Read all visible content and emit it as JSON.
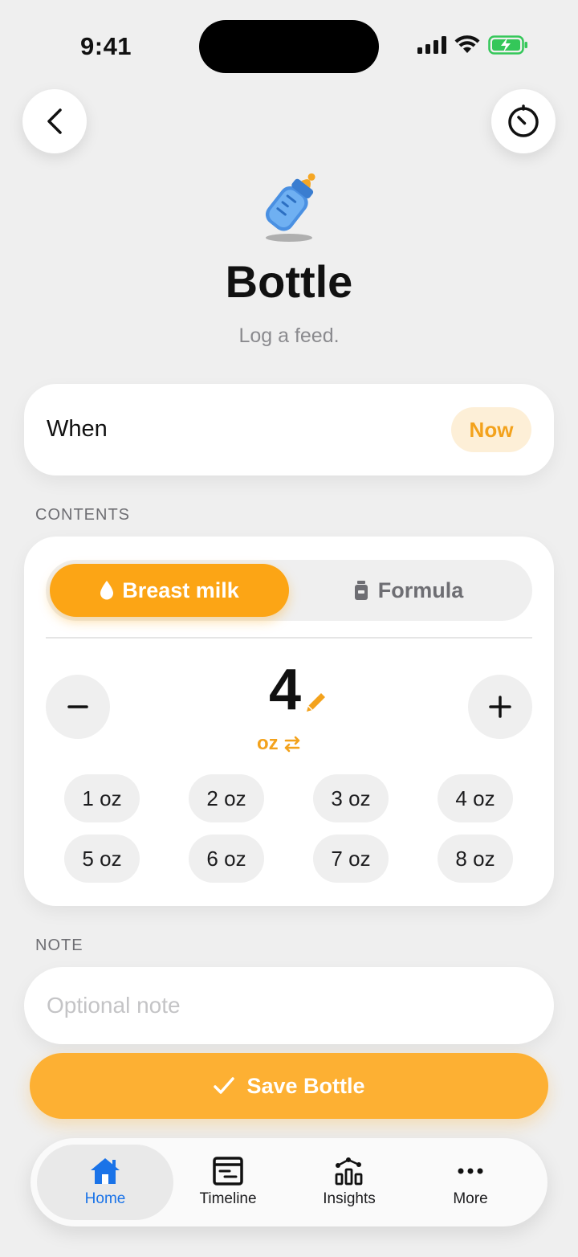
{
  "status_bar": {
    "time": "9:41"
  },
  "header": {
    "title": "Bottle",
    "subtitle": "Log a feed."
  },
  "when": {
    "label": "When",
    "value": "Now"
  },
  "contents": {
    "section_label": "CONTENTS",
    "segments": [
      {
        "label": "Breast milk",
        "icon": "droplet-icon",
        "selected": true
      },
      {
        "label": "Formula",
        "icon": "formula-can-icon",
        "selected": false
      }
    ],
    "amount": "4",
    "unit": "oz",
    "quick_amounts": [
      "1 oz",
      "2 oz",
      "3 oz",
      "4 oz",
      "5 oz",
      "6 oz",
      "7 oz",
      "8 oz"
    ]
  },
  "note": {
    "section_label": "NOTE",
    "placeholder": "Optional note",
    "value": ""
  },
  "save_button": {
    "label": "Save Bottle"
  },
  "tabbar": {
    "items": [
      {
        "label": "Home",
        "icon": "home-icon",
        "active": true
      },
      {
        "label": "Timeline",
        "icon": "timeline-icon",
        "active": false
      },
      {
        "label": "Insights",
        "icon": "insights-icon",
        "active": false
      },
      {
        "label": "More",
        "icon": "more-icon",
        "active": false
      }
    ]
  },
  "colors": {
    "accent": "#fca515",
    "accent_soft": "#fdefd7",
    "active_tab": "#1a73e8",
    "background": "#efefef"
  }
}
